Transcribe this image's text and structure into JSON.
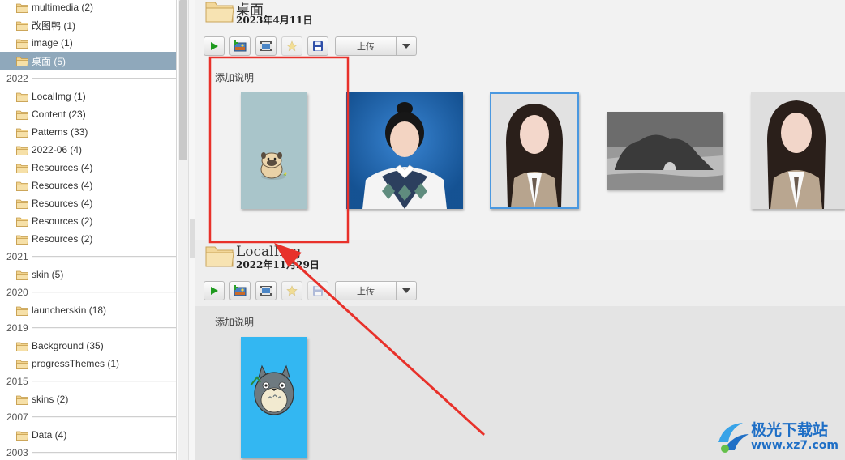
{
  "sidebar": {
    "items": [
      {
        "kind": "folder",
        "label": "multimedia (2)"
      },
      {
        "kind": "folder",
        "label": "改图鸭 (1)"
      },
      {
        "kind": "folder",
        "label": "image (1)"
      },
      {
        "kind": "folder",
        "label": "桌面 (5)",
        "selected": true
      },
      {
        "kind": "year",
        "label": "2022"
      },
      {
        "kind": "folder",
        "label": "LocalImg (1)"
      },
      {
        "kind": "folder",
        "label": "Content (23)"
      },
      {
        "kind": "folder",
        "label": "Patterns (33)"
      },
      {
        "kind": "folder",
        "label": "2022-06 (4)"
      },
      {
        "kind": "folder",
        "label": "Resources (4)"
      },
      {
        "kind": "folder",
        "label": "Resources (4)"
      },
      {
        "kind": "folder",
        "label": "Resources (4)"
      },
      {
        "kind": "folder",
        "label": "Resources (2)"
      },
      {
        "kind": "folder",
        "label": "Resources (2)"
      },
      {
        "kind": "year",
        "label": "2021"
      },
      {
        "kind": "folder",
        "label": "skin (5)"
      },
      {
        "kind": "year",
        "label": "2020"
      },
      {
        "kind": "folder",
        "label": "launcherskin (18)"
      },
      {
        "kind": "year",
        "label": "2019"
      },
      {
        "kind": "folder",
        "label": "Background (35)"
      },
      {
        "kind": "folder",
        "label": "progressThemes (1)"
      },
      {
        "kind": "year",
        "label": "2015"
      },
      {
        "kind": "folder",
        "label": "skins (2)"
      },
      {
        "kind": "year",
        "label": "2007"
      },
      {
        "kind": "folder",
        "label": "Data (4)"
      },
      {
        "kind": "year",
        "label": "2003"
      }
    ]
  },
  "albums": [
    {
      "title": "桌面",
      "date": "2023年4月11日",
      "upload_label": "上传",
      "caption": "添加说明"
    },
    {
      "title": "LocalImg",
      "date": "2022年11月29日",
      "upload_label": "上传",
      "caption": "添加说明"
    }
  ],
  "toolbar_icons": [
    "play-icon",
    "add-photo-icon",
    "slideshow-icon",
    "star-icon",
    "save-icon"
  ],
  "colors": {
    "selection": "#8fa8bb",
    "annotation": "#e8312a",
    "main_bg": "#ececec",
    "watermark": "#1f6fc6"
  },
  "watermark": {
    "title": "极光下载站",
    "url": "www.xz7.com"
  }
}
